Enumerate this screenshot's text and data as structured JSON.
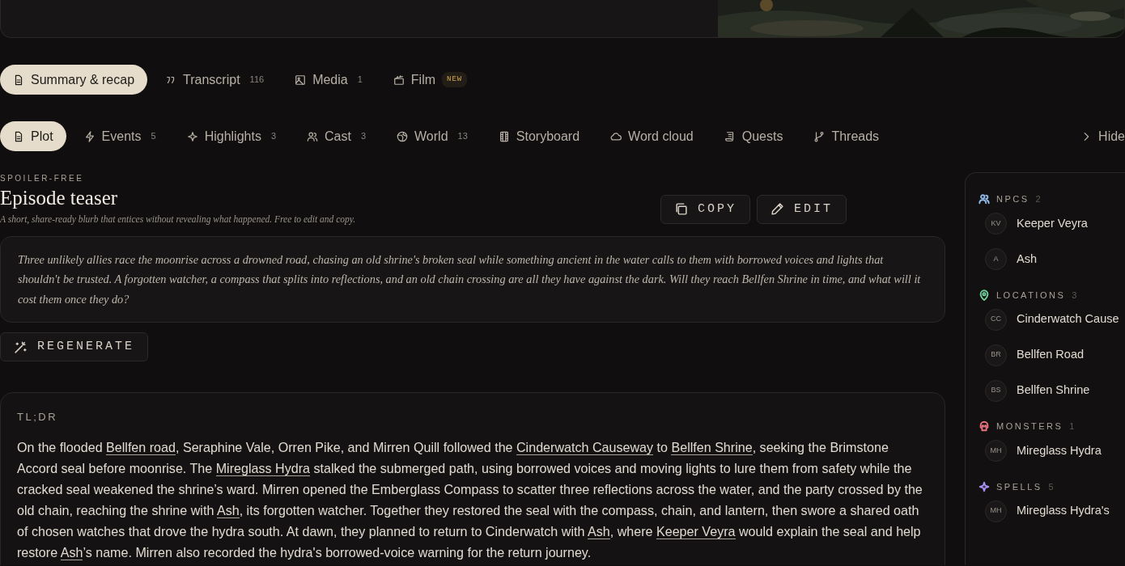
{
  "view_tabs": [
    {
      "label": "Summary & recap",
      "selected": true
    },
    {
      "label": "Transcript",
      "count": "116",
      "selected": false
    },
    {
      "label": "Media",
      "count": "1",
      "selected": false
    },
    {
      "label": "Film",
      "badge": "NEW",
      "selected": false
    }
  ],
  "section_tabs": [
    {
      "label": "Plot",
      "selected": true
    },
    {
      "label": "Events",
      "count": "5",
      "selected": false
    },
    {
      "label": "Highlights",
      "count": "3",
      "selected": false
    },
    {
      "label": "Cast",
      "count": "3",
      "selected": false
    },
    {
      "label": "World",
      "count": "13",
      "selected": false
    },
    {
      "label": "Storyboard",
      "selected": false
    },
    {
      "label": "Word cloud",
      "selected": false
    },
    {
      "label": "Quests",
      "selected": false
    },
    {
      "label": "Threads",
      "selected": false
    }
  ],
  "hide_toggle": {
    "label": "Hide"
  },
  "teaser": {
    "eyebrow": "SPOILER-FREE",
    "title": "Episode teaser",
    "subtitle": "A short, share-ready blurb that entices without revealing what happened. Free to edit and copy.",
    "buttons": [
      "COPY",
      "EDIT"
    ],
    "text": "Three unlikely allies race the moonrise across a drowned road, chasing an old shrine's broken seal while something ancient in the water calls to them with borrowed voices and lights that shouldn't be trusted. A forgotten watcher, a compass that splits into reflections, and an old chain crossing are all they have against the dark. Will they reach Bellfen Shrine in time, and what will it cost them once they do?",
    "regenerate": "REGENERATE"
  },
  "tldr": {
    "label": "TL;DR",
    "segments": [
      {
        "text": "On the flooded ",
        "link": false
      },
      {
        "text": "Bellfen road",
        "link": true
      },
      {
        "text": ", Seraphine Vale, Orren Pike, and Mirren Quill followed the ",
        "link": false
      },
      {
        "text": "Cinderwatch Causeway",
        "link": true
      },
      {
        "text": " to ",
        "link": false
      },
      {
        "text": "Bellfen Shrine",
        "link": true
      },
      {
        "text": ", seeking the Brimstone Accord seal before moonrise. The ",
        "link": false
      },
      {
        "text": "Mireglass Hydra",
        "link": true
      },
      {
        "text": " stalked the submerged path, using borrowed voices and moving lights to lure them from safety while the cracked seal weakened the shrine’s ward. Mirren opened the Emberglass Compass to scatter three reflections across the water, and the party crossed by the old chain, reaching the shrine with ",
        "link": false
      },
      {
        "text": "Ash",
        "link": true
      },
      {
        "text": ", its forgotten watcher. Together they restored the seal with the compass, chain, and lantern, then swore a shared oath of chosen watches that drove the hydra south. At dawn, they planned to return to Cinderwatch with ",
        "link": false
      },
      {
        "text": "Ash",
        "link": true
      },
      {
        "text": ", where ",
        "link": false
      },
      {
        "text": "Keeper Veyra",
        "link": true
      },
      {
        "text": " would explain the seal and help restore ",
        "link": false
      },
      {
        "text": "Ash",
        "link": true
      },
      {
        "text": "’s name. Mirren also recorded the hydra's borrowed-voice warning for the return journey.",
        "link": false
      }
    ]
  },
  "sidebar": {
    "sections": [
      {
        "title": "NPCS",
        "count": "2",
        "color": "#8fb8e8",
        "items": [
          {
            "initials": "KV",
            "name": "Keeper Veyra"
          },
          {
            "initials": "A",
            "name": "Ash"
          }
        ]
      },
      {
        "title": "LOCATIONS",
        "count": "3",
        "color": "#6fcf97",
        "items": [
          {
            "initials": "CC",
            "name": "Cinderwatch Cause"
          },
          {
            "initials": "BR",
            "name": "Bellfen Road"
          },
          {
            "initials": "BS",
            "name": "Bellfen Shrine"
          }
        ]
      },
      {
        "title": "MONSTERS",
        "count": "1",
        "color": "#e8737a",
        "items": [
          {
            "initials": "MH",
            "name": "Mireglass Hydra"
          }
        ]
      },
      {
        "title": "SPELLS",
        "count": "5",
        "color": "#a98ff0",
        "items": [
          {
            "initials": "MH",
            "name": "Mireglass Hydra's"
          }
        ]
      }
    ]
  }
}
